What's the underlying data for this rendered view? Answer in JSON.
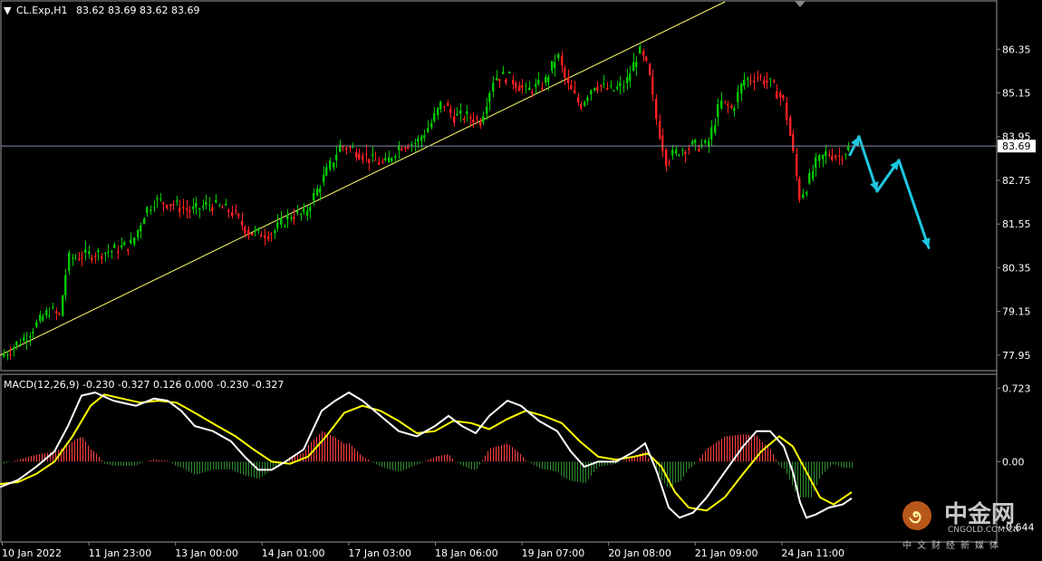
{
  "chart_data": {
    "type": "candlestick",
    "symbol_header": "CL.Exp,H1",
    "ohlc_header": "83.62 83.69 83.62 83.69",
    "price_axis": {
      "ticks": [
        "86.35",
        "85.15",
        "83.95",
        "82.75",
        "81.55",
        "80.35",
        "79.15",
        "77.95"
      ],
      "current_price": "83.69",
      "range": [
        77.55,
        87.65
      ]
    },
    "time_axis": {
      "ticks": [
        "10 Jan 2022",
        "11 Jan 23:00",
        "13 Jan 00:00",
        "14 Jan 01:00",
        "17 Jan 03:00",
        "18 Jan 06:00",
        "19 Jan 07:00",
        "20 Jan 08:00",
        "21 Jan 09:00",
        "24 Jan 11:00"
      ]
    },
    "price_path": [
      [
        0,
        77.9
      ],
      [
        10,
        78.1
      ],
      [
        25,
        78.4
      ],
      [
        40,
        78.8
      ],
      [
        55,
        79.2
      ],
      [
        65,
        79.0
      ],
      [
        75,
        80.6
      ],
      [
        95,
        80.7
      ],
      [
        120,
        80.8
      ],
      [
        145,
        81.0
      ],
      [
        160,
        81.9
      ],
      [
        170,
        82.2
      ],
      [
        190,
        82.1
      ],
      [
        210,
        81.9
      ],
      [
        230,
        82.1
      ],
      [
        255,
        81.9
      ],
      [
        275,
        81.3
      ],
      [
        300,
        81.3
      ],
      [
        320,
        81.8
      ],
      [
        335,
        81.8
      ],
      [
        350,
        82.5
      ],
      [
        365,
        83.2
      ],
      [
        375,
        83.7
      ],
      [
        390,
        83.6
      ],
      [
        410,
        83.3
      ],
      [
        425,
        83.2
      ],
      [
        440,
        83.7
      ],
      [
        460,
        83.8
      ],
      [
        475,
        84.3
      ],
      [
        488,
        84.9
      ],
      [
        500,
        84.5
      ],
      [
        515,
        84.5
      ],
      [
        530,
        84.4
      ],
      [
        545,
        85.6
      ],
      [
        560,
        85.6
      ],
      [
        580,
        85.2
      ],
      [
        600,
        85.4
      ],
      [
        615,
        86.2
      ],
      [
        625,
        85.4
      ],
      [
        640,
        84.8
      ],
      [
        655,
        85.4
      ],
      [
        675,
        85.2
      ],
      [
        690,
        85.4
      ],
      [
        705,
        86.3
      ],
      [
        715,
        85.8
      ],
      [
        725,
        84.3
      ],
      [
        735,
        83.3
      ],
      [
        750,
        83.6
      ],
      [
        765,
        83.7
      ],
      [
        780,
        83.7
      ],
      [
        795,
        84.9
      ],
      [
        808,
        84.7
      ],
      [
        820,
        85.5
      ],
      [
        835,
        85.6
      ],
      [
        850,
        85.4
      ],
      [
        865,
        84.9
      ],
      [
        875,
        83.5
      ],
      [
        882,
        82.3
      ],
      [
        890,
        82.6
      ],
      [
        900,
        83.2
      ],
      [
        912,
        83.5
      ],
      [
        925,
        83.4
      ],
      [
        940,
        83.69
      ]
    ],
    "trendline": {
      "from": [
        0,
        77.95
      ],
      "to": [
        800,
        87.65
      ]
    },
    "projection": [
      [
        938,
        83.45
      ],
      [
        948,
        83.95
      ],
      [
        968,
        82.45
      ],
      [
        992,
        83.3
      ],
      [
        1025,
        80.9
      ]
    ],
    "macd": {
      "title": "MACD(12,26,9) -0.230 -0.327 0.126 0.000 -0.230 -0.327",
      "ticks": [
        "0.723",
        "0.00",
        "-0.644"
      ],
      "range": [
        -0.78,
        0.85
      ],
      "macd_line": [
        [
          0,
          -0.25
        ],
        [
          20,
          -0.18
        ],
        [
          40,
          -0.05
        ],
        [
          60,
          0.1
        ],
        [
          75,
          0.35
        ],
        [
          90,
          0.65
        ],
        [
          105,
          0.68
        ],
        [
          125,
          0.6
        ],
        [
          150,
          0.55
        ],
        [
          170,
          0.62
        ],
        [
          185,
          0.6
        ],
        [
          200,
          0.5
        ],
        [
          215,
          0.35
        ],
        [
          235,
          0.3
        ],
        [
          255,
          0.2
        ],
        [
          270,
          0.05
        ],
        [
          285,
          -0.08
        ],
        [
          300,
          -0.08
        ],
        [
          315,
          0.0
        ],
        [
          335,
          0.12
        ],
        [
          355,
          0.5
        ],
        [
          370,
          0.6
        ],
        [
          385,
          0.68
        ],
        [
          400,
          0.6
        ],
        [
          420,
          0.45
        ],
        [
          440,
          0.3
        ],
        [
          460,
          0.25
        ],
        [
          480,
          0.35
        ],
        [
          495,
          0.45
        ],
        [
          510,
          0.35
        ],
        [
          525,
          0.28
        ],
        [
          540,
          0.45
        ],
        [
          560,
          0.6
        ],
        [
          575,
          0.55
        ],
        [
          595,
          0.4
        ],
        [
          615,
          0.3
        ],
        [
          630,
          0.1
        ],
        [
          645,
          -0.05
        ],
        [
          660,
          0.0
        ],
        [
          680,
          0.0
        ],
        [
          700,
          0.1
        ],
        [
          712,
          0.18
        ],
        [
          725,
          -0.1
        ],
        [
          738,
          -0.45
        ],
        [
          750,
          -0.55
        ],
        [
          765,
          -0.5
        ],
        [
          780,
          -0.35
        ],
        [
          800,
          -0.1
        ],
        [
          820,
          0.15
        ],
        [
          835,
          0.3
        ],
        [
          850,
          0.3
        ],
        [
          865,
          0.15
        ],
        [
          875,
          -0.1
        ],
        [
          883,
          -0.4
        ],
        [
          890,
          -0.55
        ],
        [
          900,
          -0.52
        ],
        [
          915,
          -0.45
        ],
        [
          930,
          -0.42
        ],
        [
          940,
          -0.36
        ]
      ],
      "signal_line": [
        [
          0,
          -0.22
        ],
        [
          20,
          -0.2
        ],
        [
          40,
          -0.12
        ],
        [
          60,
          0.0
        ],
        [
          80,
          0.25
        ],
        [
          100,
          0.55
        ],
        [
          115,
          0.66
        ],
        [
          135,
          0.62
        ],
        [
          155,
          0.58
        ],
        [
          175,
          0.6
        ],
        [
          195,
          0.58
        ],
        [
          215,
          0.48
        ],
        [
          240,
          0.35
        ],
        [
          260,
          0.25
        ],
        [
          280,
          0.12
        ],
        [
          300,
          0.0
        ],
        [
          320,
          -0.02
        ],
        [
          340,
          0.05
        ],
        [
          360,
          0.25
        ],
        [
          380,
          0.48
        ],
        [
          400,
          0.55
        ],
        [
          420,
          0.5
        ],
        [
          440,
          0.4
        ],
        [
          460,
          0.28
        ],
        [
          480,
          0.3
        ],
        [
          500,
          0.4
        ],
        [
          520,
          0.38
        ],
        [
          540,
          0.32
        ],
        [
          560,
          0.42
        ],
        [
          580,
          0.5
        ],
        [
          600,
          0.45
        ],
        [
          620,
          0.38
        ],
        [
          640,
          0.2
        ],
        [
          660,
          0.05
        ],
        [
          680,
          0.02
        ],
        [
          700,
          0.05
        ],
        [
          715,
          0.08
        ],
        [
          730,
          -0.05
        ],
        [
          745,
          -0.3
        ],
        [
          760,
          -0.45
        ],
        [
          780,
          -0.48
        ],
        [
          800,
          -0.35
        ],
        [
          820,
          -0.12
        ],
        [
          840,
          0.1
        ],
        [
          860,
          0.25
        ],
        [
          875,
          0.15
        ],
        [
          890,
          -0.1
        ],
        [
          905,
          -0.35
        ],
        [
          920,
          -0.42
        ],
        [
          940,
          -0.3
        ]
      ]
    }
  },
  "watermark": {
    "cn": "中金网",
    "en": "CNGOLD.COM.CN",
    "sub": "中文财经新媒体"
  },
  "colors": {
    "background": "#000000",
    "bull": "#00c800",
    "bear": "#ff2020",
    "trendline": "#ffff66",
    "projection": "#1ec8e0",
    "macd_line": "#ffffff",
    "signal_line": "#ffff00",
    "hist_pos": "#ff4040",
    "hist_neg": "#2e8b2e",
    "grid": "#808080"
  }
}
